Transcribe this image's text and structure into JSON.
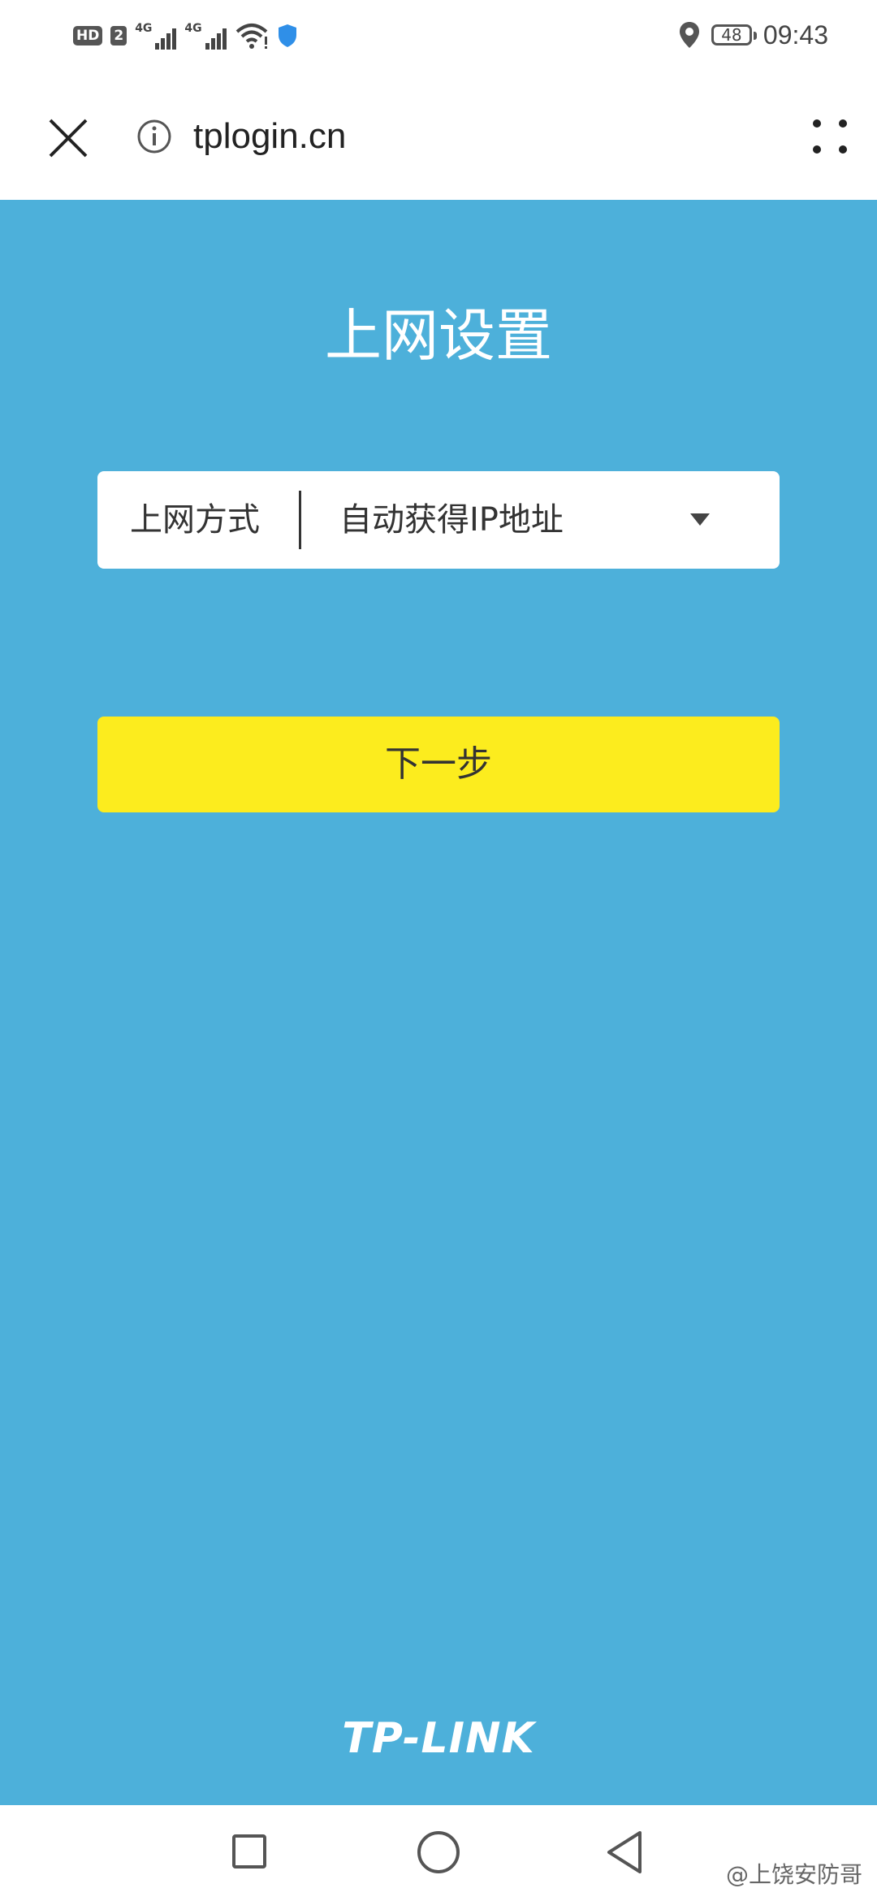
{
  "status_bar": {
    "hd": "HD",
    "sim": "2",
    "net1": "4G",
    "net2": "4G",
    "battery": "48",
    "time": "09:43"
  },
  "browser": {
    "url": "tplogin.cn"
  },
  "page": {
    "title": "上网设置",
    "connection": {
      "label": "上网方式",
      "value": "自动获得IP地址"
    },
    "next_button": "下一步",
    "logo": "TP-LINK"
  },
  "watermark": "@上饶安防哥",
  "colors": {
    "background": "#4db0da",
    "button": "#fcec1e"
  }
}
